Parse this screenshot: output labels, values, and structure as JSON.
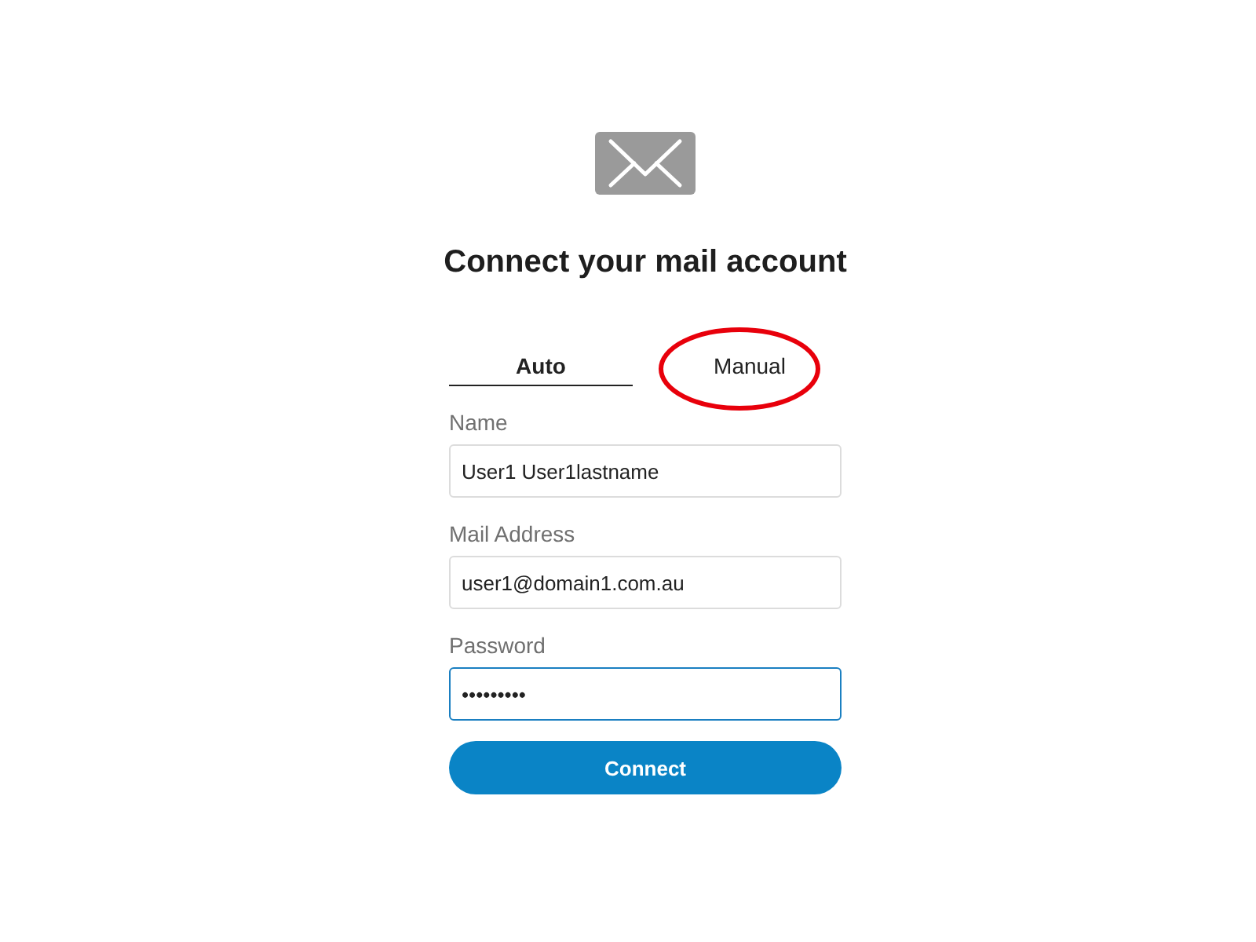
{
  "header": {
    "title": "Connect your mail account"
  },
  "tabs": [
    {
      "label": "Auto",
      "selected": true,
      "circled": false
    },
    {
      "label": "Manual",
      "selected": false,
      "circled": true
    }
  ],
  "fields": [
    {
      "label": "Name",
      "value": "User1 User1lastname",
      "focused": false
    },
    {
      "label": "Mail Address",
      "value": "user1@domain1.com.au",
      "focused": false
    },
    {
      "label": "Password",
      "value": "•••••••••",
      "focused": true
    }
  ],
  "button": {
    "label": "Connect"
  }
}
